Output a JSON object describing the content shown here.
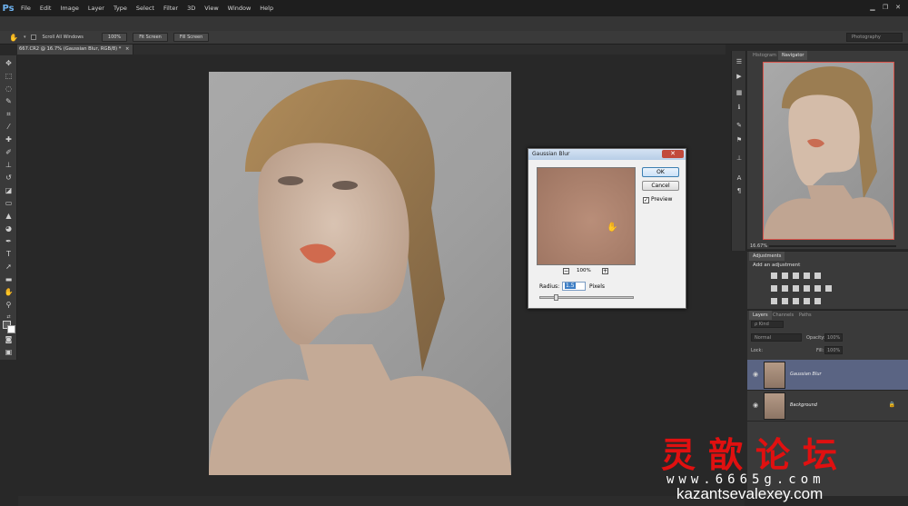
{
  "app": {
    "logo": "Ps",
    "menu": [
      "File",
      "Edit",
      "Image",
      "Layer",
      "Type",
      "Select",
      "Filter",
      "3D",
      "View",
      "Window",
      "Help"
    ],
    "window_controls": [
      "▁",
      "❐",
      "✕"
    ]
  },
  "options_bar": {
    "scroll_all_windows": "Scroll All Windows",
    "btn_100": "100%",
    "btn_fit_screen": "Fit Screen",
    "btn_fill_screen": "Fill Screen",
    "workspace": "Photography"
  },
  "document": {
    "tab_title": "667.CR2 @ 16.7% (Gaussian Blur, RGB/8) *",
    "tab_close": "×"
  },
  "tools": [
    "move-tool",
    "marquee-tool",
    "lasso-tool",
    "quick-select-tool",
    "crop-tool",
    "eyedropper-tool",
    "healing-tool",
    "brush-tool",
    "clone-stamp-tool",
    "history-brush-tool",
    "eraser-tool",
    "gradient-tool",
    "blur-tool",
    "dodge-tool",
    "pen-tool",
    "type-tool",
    "path-select-tool",
    "shape-tool",
    "hand-tool",
    "zoom-tool"
  ],
  "dialog": {
    "title": "Gaussian Blur",
    "close": "✕",
    "ok": "OK",
    "cancel": "Cancel",
    "preview_label": "Preview",
    "preview_checked": "✓",
    "zoom_out": "−",
    "zoom_in": "+",
    "zoom_value": "100%",
    "radius_label": "Radius:",
    "radius_value": "1.5",
    "radius_unit": "Pixels"
  },
  "panels": {
    "nav_tabs": [
      "Histogram",
      "Navigator"
    ],
    "nav_zoom": "16.67%",
    "adjustments_tab": "Adjustments",
    "adjustments_title": "Add an adjustment",
    "layer_tabs": [
      "Layers",
      "Channels",
      "Paths"
    ],
    "layer_filter": "ρ Kind",
    "blend_mode": "Normal",
    "opacity_label": "Opacity:",
    "opacity_value": "100%",
    "lock_label": "Lock:",
    "fill_label": "Fill:",
    "fill_value": "100%",
    "layers": [
      {
        "name": "Gaussian Blur",
        "selected": true
      },
      {
        "name": "Background",
        "selected": false,
        "locked": true
      }
    ]
  },
  "watermark": {
    "chinese": "灵歆论坛",
    "url": "www.6665g.com",
    "site": "kazantsevalexey.com"
  },
  "colors": {
    "accent_red": "#e01010",
    "selected_layer": "#5a6483",
    "navigator_frame": "#d9544b"
  }
}
